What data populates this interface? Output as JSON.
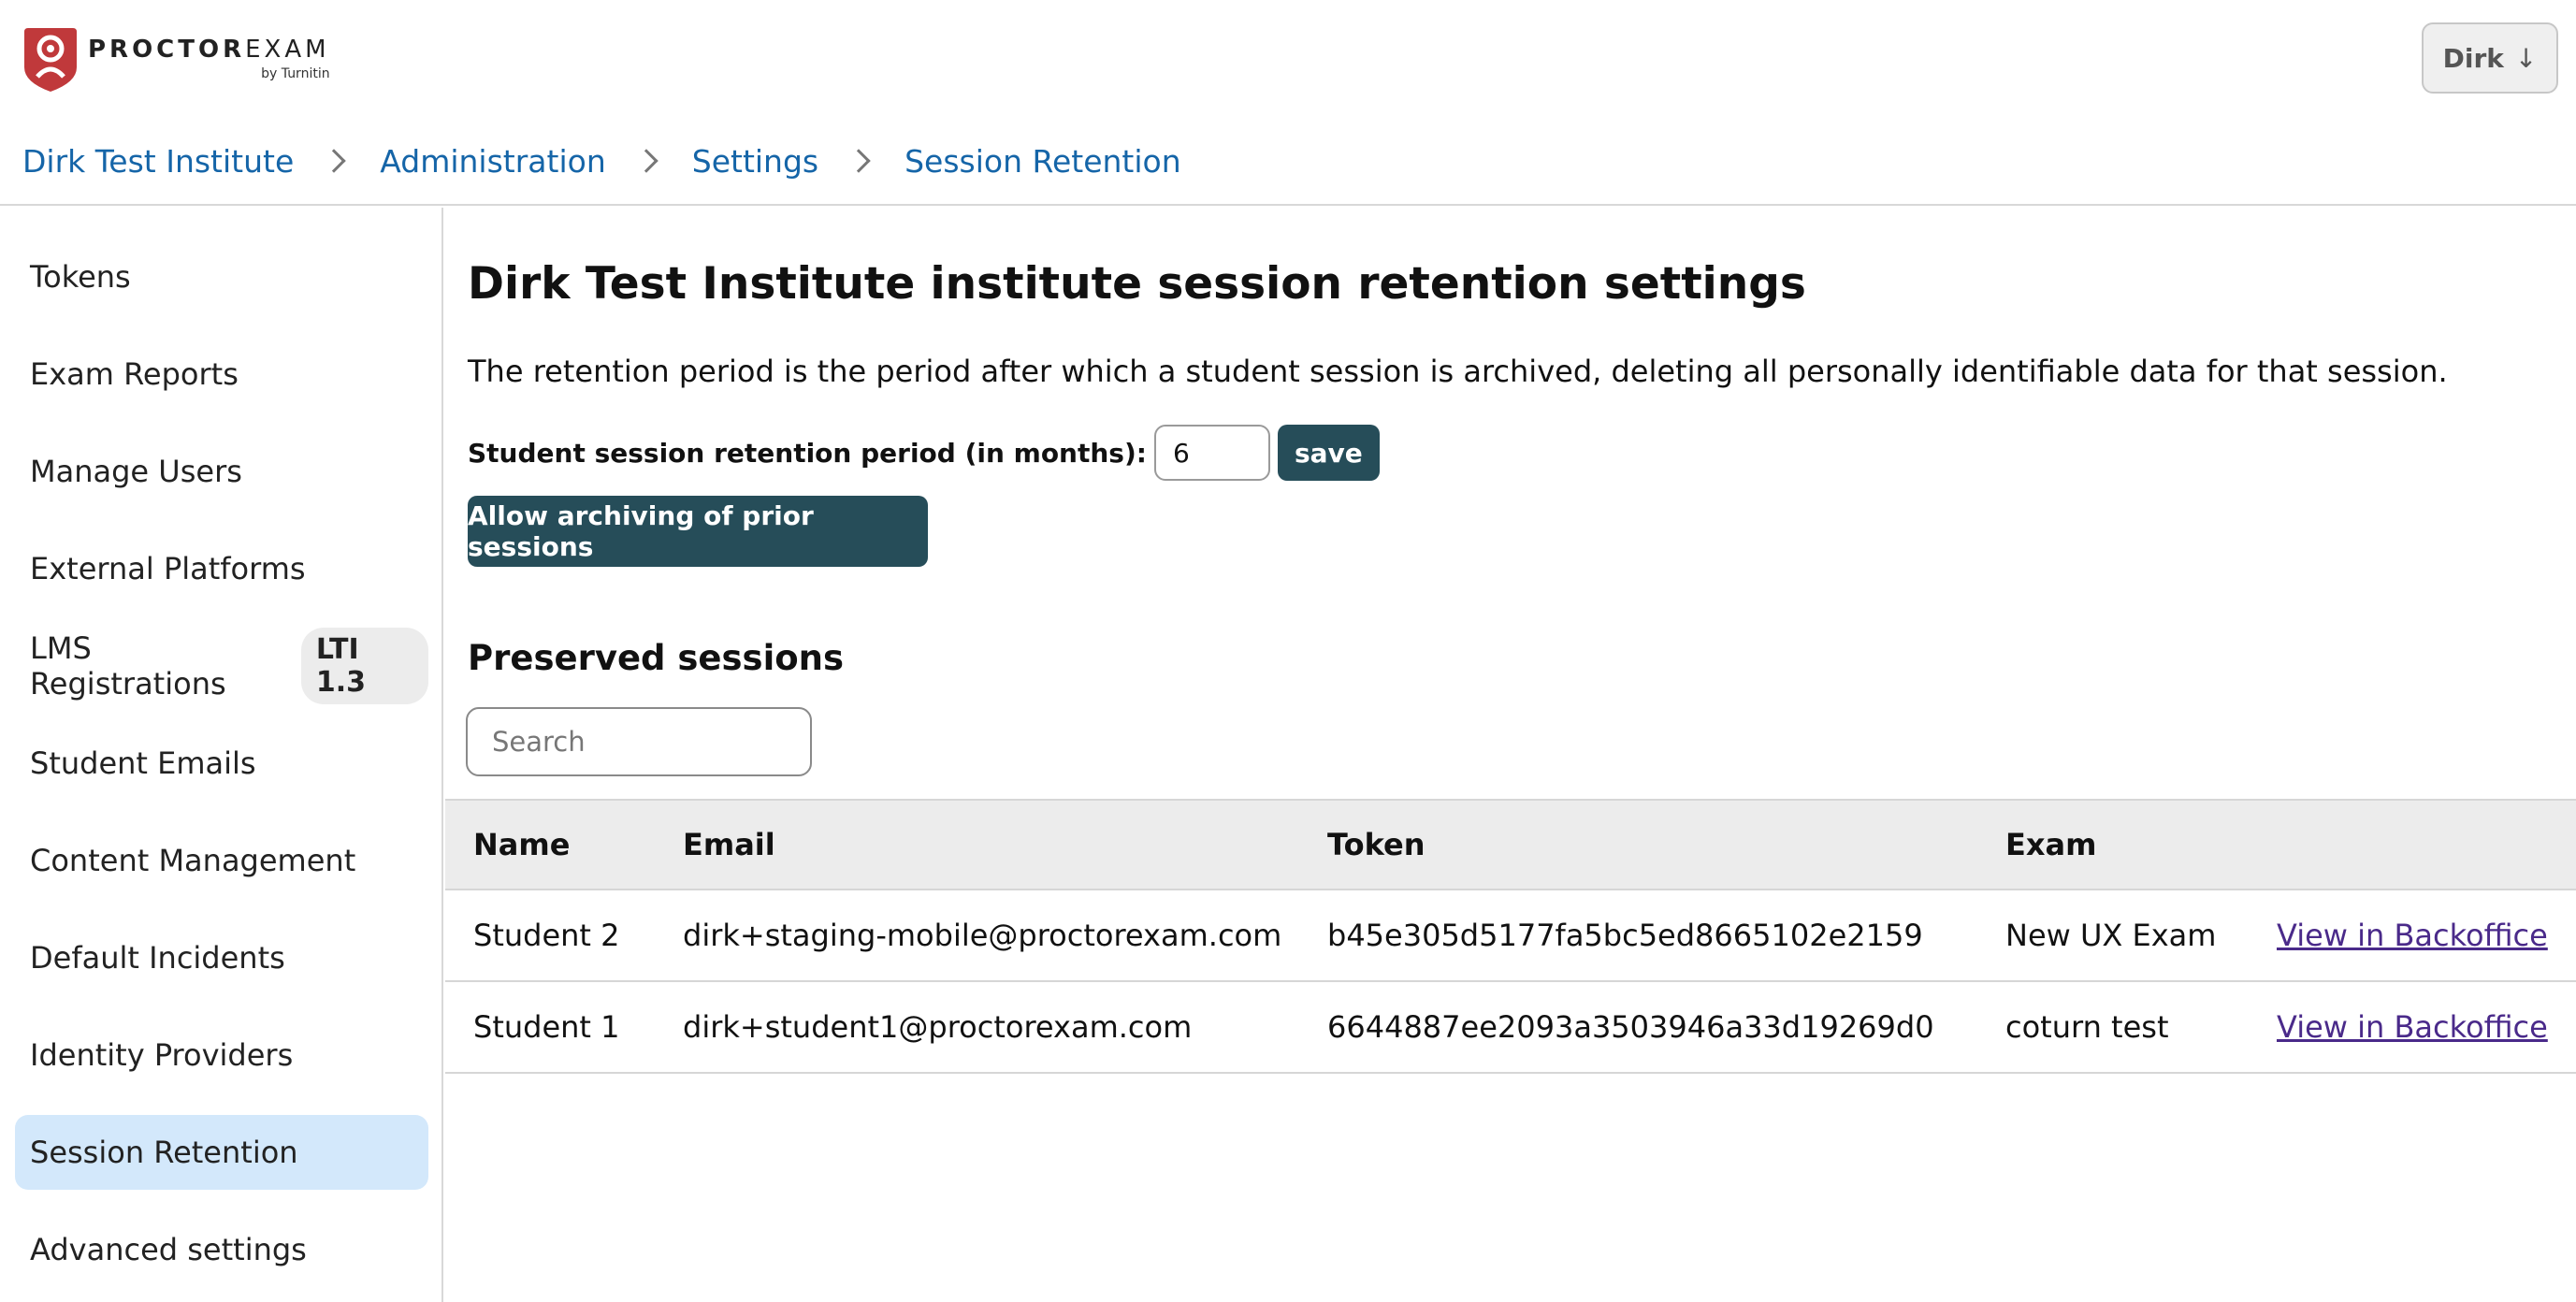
{
  "header": {
    "logo": {
      "name_bold": "PROCTOR",
      "name_light": "EXAM",
      "by": "by Turnitin"
    },
    "user": {
      "label": "Dirk",
      "arrow": "↓"
    }
  },
  "breadcrumb": [
    "Dirk Test Institute",
    "Administration",
    "Settings",
    "Session Retention"
  ],
  "sidebar": {
    "items": [
      {
        "label": "Tokens"
      },
      {
        "label": "Exam Reports"
      },
      {
        "label": "Manage Users"
      },
      {
        "label": "External Platforms"
      },
      {
        "label": "LMS Registrations",
        "badge": "LTI 1.3"
      },
      {
        "label": "Student Emails"
      },
      {
        "label": "Content Management"
      },
      {
        "label": "Default Incidents"
      },
      {
        "label": "Identity Providers"
      },
      {
        "label": "Session Retention",
        "active": true
      },
      {
        "label": "Advanced settings"
      }
    ]
  },
  "main": {
    "title": "Dirk Test Institute institute session retention settings",
    "description": "The retention period is the period after which a student session is archived, deleting all personally identifiable data for that session.",
    "retention": {
      "label": "Student session retention period (in months):",
      "value": "6",
      "save_label": "save"
    },
    "archive_button": "Allow archiving of prior sessions",
    "preserved": {
      "title": "Preserved sessions",
      "search_placeholder": "Search",
      "columns": [
        "Name",
        "Email",
        "Token",
        "Exam"
      ],
      "rows": [
        {
          "name": "Student 2",
          "email": "dirk+staging-mobile@proctorexam.com",
          "token": "b45e305d5177fa5bc5ed8665102e2159",
          "exam": "New UX Exam",
          "link": "View in Backoffice"
        },
        {
          "name": "Student 1",
          "email": "dirk+student1@proctorexam.com",
          "token": "6644887ee2093a3503946a33d19269d0",
          "exam": "coturn test",
          "link": "View in Backoffice"
        }
      ]
    }
  },
  "colors": {
    "accent": "#264d59",
    "link": "#1565a8",
    "active_nav": "#d3e8fb",
    "logo_red": "#c0393b"
  }
}
